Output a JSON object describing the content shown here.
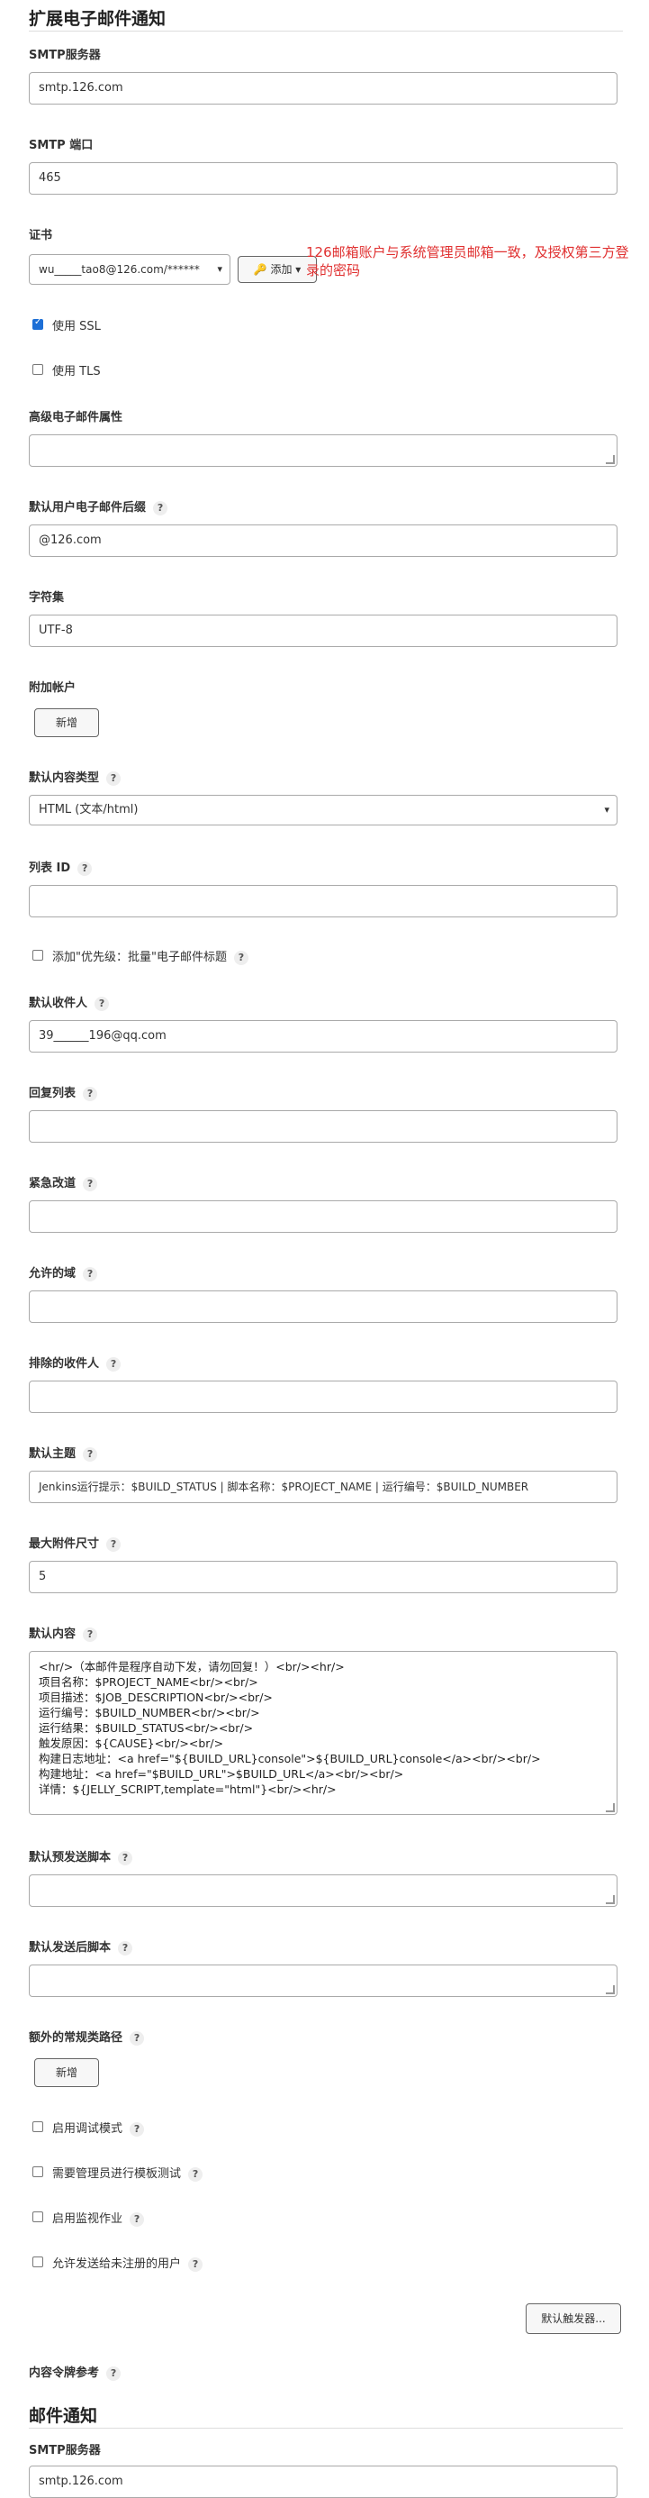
{
  "section1": {
    "title": "扩展电子邮件通知"
  },
  "smtp_server": {
    "label": "SMTP服务器",
    "value": "smtp.126.com"
  },
  "smtp_port": {
    "label": "SMTP 端口",
    "value": "465"
  },
  "credentials": {
    "label": "证书",
    "selected": "wu_____tao8@126.com/******",
    "add_label": "添加",
    "note": "126邮箱账户与系统管理员邮箱一致，及授权第三方登录的密码"
  },
  "ssl": {
    "label": "使用 SSL",
    "checked": true
  },
  "tls": {
    "label": "使用 TLS",
    "checked": false
  },
  "advanced_props": {
    "label": "高级电子邮件属性"
  },
  "default_suffix": {
    "label": "默认用户电子邮件后缀",
    "value": "@126.com"
  },
  "charset": {
    "label": "字符集",
    "value": "UTF-8"
  },
  "extra_accounts": {
    "label": "附加帐户",
    "add_label": "新增"
  },
  "content_type": {
    "label": "默认内容类型",
    "value": "HTML (文本/html)"
  },
  "list_id": {
    "label": "列表 ID"
  },
  "precedence": {
    "label": "添加\"优先级：批量\"电子邮件标题"
  },
  "default_recipients": {
    "label": "默认收件人",
    "value": "39______196@qq.com"
  },
  "reply_to": {
    "label": "回复列表"
  },
  "emergency_reroute": {
    "label": "紧急改道"
  },
  "allowed_domains": {
    "label": "允许的域"
  },
  "excluded_recipients": {
    "label": "排除的收件人"
  },
  "default_subject": {
    "label": "默认主题",
    "value": "Jenkins运行提示：$BUILD_STATUS | 脚本名称：$PROJECT_NAME | 运行编号：$BUILD_NUMBER"
  },
  "max_attachment": {
    "label": "最大附件尺寸",
    "value": "5"
  },
  "default_content": {
    "label": "默认内容",
    "lines": [
      "<hr/>（本邮件是程序自动下发，请勿回复！）<br/><hr/>",
      "项目名称：$PROJECT_NAME<br/><br/>",
      "项目描述：$JOB_DESCRIPTION<br/><br/>",
      "运行编号：$BUILD_NUMBER<br/><br/>",
      "运行结果：$BUILD_STATUS<br/><br/>",
      "触发原因：${CAUSE}<br/><br/>",
      "构建日志地址：<a href=\"${BUILD_URL}console\">${BUILD_URL}console</a><br/><br/>",
      "构建地址：<a href=\"$BUILD_URL\">$BUILD_URL</a><br/><br/>",
      "详情：${JELLY_SCRIPT,template=\"html\"}<br/><hr/>"
    ]
  },
  "pre_send_script": {
    "label": "默认预发送脚本"
  },
  "post_send_script": {
    "label": "默认发送后脚本"
  },
  "classpath": {
    "label": "额外的常规类路径",
    "add_label": "新增"
  },
  "debug_mode": {
    "label": "启用调试模式"
  },
  "admin_required": {
    "label": "需要管理员进行模板测试"
  },
  "watching": {
    "label": "启用监视作业"
  },
  "unregistered": {
    "label": "允许发送给未注册的用户"
  },
  "default_triggers": {
    "label": "默认触发器..."
  },
  "token_ref": {
    "label": "内容令牌参考"
  },
  "section2": {
    "title": "邮件通知"
  },
  "smtp_server2": {
    "label": "SMTP服务器",
    "value": "smtp.126.com"
  },
  "help_glyph": "?"
}
